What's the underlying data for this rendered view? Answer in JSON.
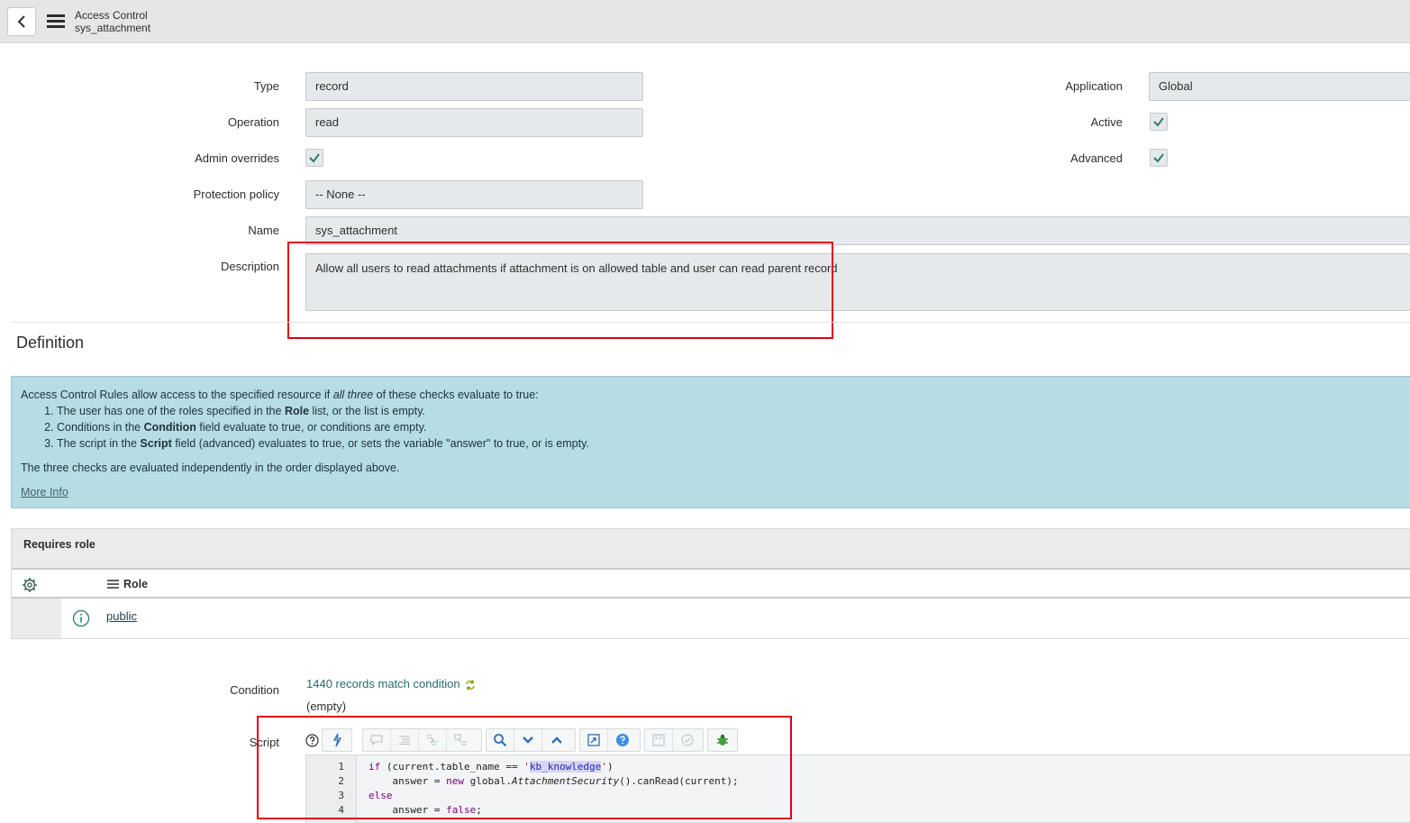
{
  "header": {
    "title": "Access Control",
    "subtitle": "sys_attachment"
  },
  "form": {
    "type_label": "Type",
    "type_value": "record",
    "operation_label": "Operation",
    "operation_value": "read",
    "admin_overrides_label": "Admin overrides",
    "protection_policy_label": "Protection policy",
    "protection_policy_value": "-- None --",
    "name_label": "Name",
    "name_value": "sys_attachment",
    "description_label": "Description",
    "description_value": "Allow all users to read attachments if attachment is on allowed table and user can read parent record",
    "application_label": "Application",
    "application_value": "Global",
    "active_label": "Active",
    "advanced_label": "Advanced"
  },
  "definition": {
    "title": "Definition",
    "info_intro_a": "Access Control Rules allow access to the specified resource if ",
    "info_intro_em": "all three",
    "info_intro_b": " of these checks evaluate to true:",
    "items": [
      {
        "a": "The user has one of the roles specified in the ",
        "b": "Role",
        "c": " list, or the list is empty."
      },
      {
        "a": "Conditions in the ",
        "b": "Condition",
        "c": " field evaluate to true, or conditions are empty."
      },
      {
        "a": "The script in the ",
        "b": "Script",
        "c": " field (advanced) evaluates to true, or sets the variable \"answer\" to true, or is empty."
      }
    ],
    "note": "The three checks are evaluated independently in the order displayed above.",
    "more_info": "More Info"
  },
  "roles": {
    "title": "Requires role",
    "column": "Role",
    "rows": [
      {
        "role": "public"
      }
    ]
  },
  "condition": {
    "label": "Condition",
    "link": "1440 records match condition",
    "value": "(empty)"
  },
  "script": {
    "label": "Script",
    "lines": [
      {
        "n": "1",
        "parts": [
          {
            "t": "if",
            "c": "kw"
          },
          {
            "t": " (current.table_name == ",
            "c": ""
          },
          {
            "t": "'",
            "c": "str"
          },
          {
            "t": "kb_knowledge",
            "c": "strsel"
          },
          {
            "t": "'",
            "c": "str"
          },
          {
            "t": ")",
            "c": ""
          }
        ]
      },
      {
        "n": "2",
        "parts": [
          {
            "t": "    answer = ",
            "c": ""
          },
          {
            "t": "new",
            "c": "kw"
          },
          {
            "t": " global.",
            "c": ""
          },
          {
            "t": "AttachmentSecurity",
            "c": "fn"
          },
          {
            "t": "().canRead(current);",
            "c": ""
          }
        ]
      },
      {
        "n": "3",
        "parts": [
          {
            "t": "else",
            "c": "kw"
          }
        ]
      },
      {
        "n": "4",
        "parts": [
          {
            "t": "    answer = ",
            "c": ""
          },
          {
            "t": "false",
            "c": "kw"
          },
          {
            "t": ";",
            "c": ""
          }
        ]
      }
    ]
  },
  "colors": {
    "accent": "#278efc",
    "info_bg": "#b6dde4",
    "highlight_red": "#e0001b",
    "check_green": "#2e7d6e"
  }
}
